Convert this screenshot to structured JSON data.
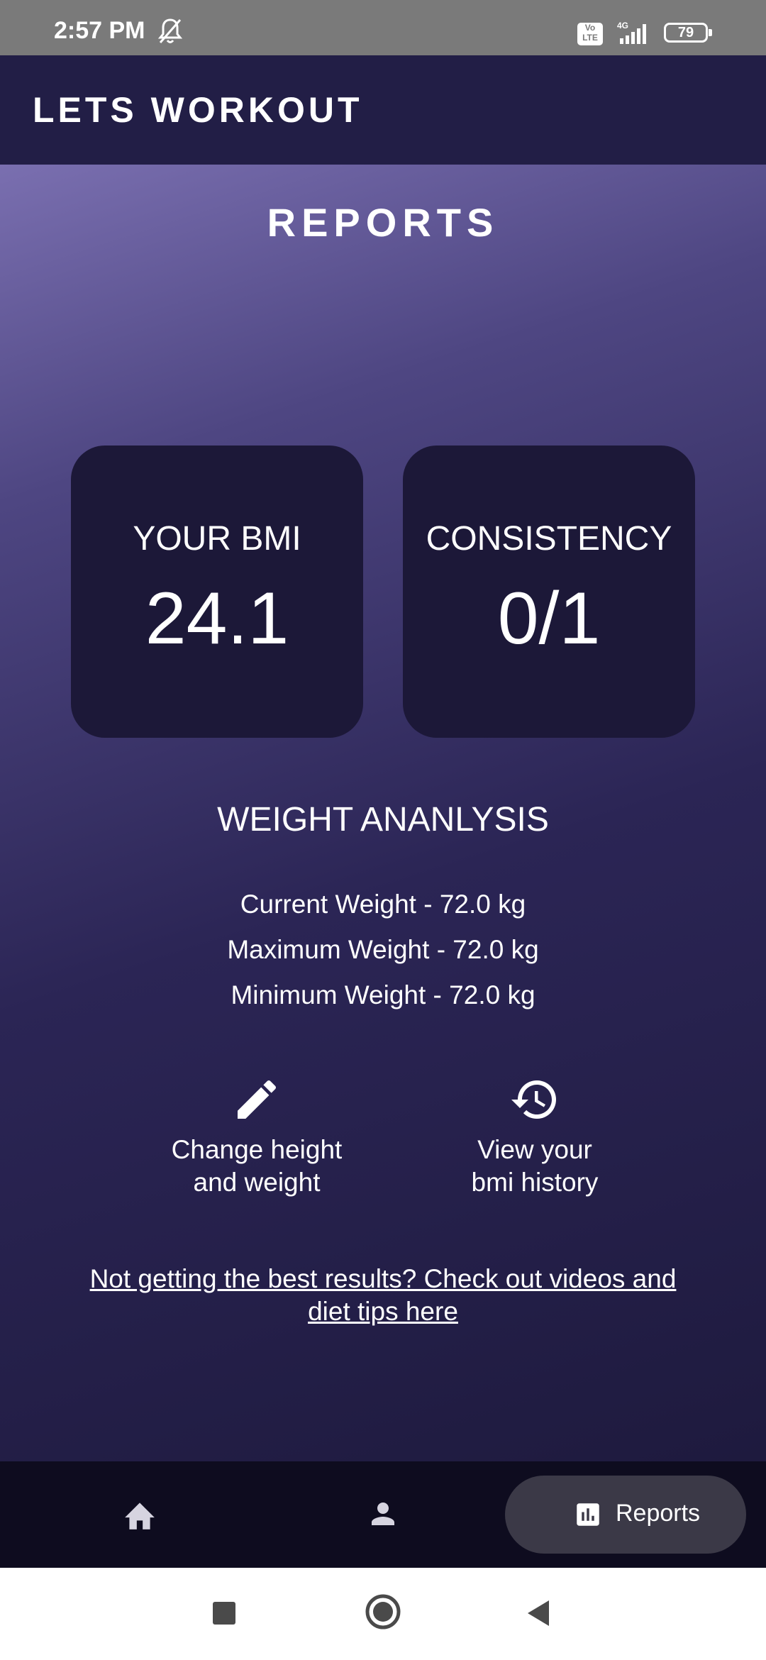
{
  "status_bar": {
    "time": "2:57 PM",
    "volte": "Vo LTE",
    "network": "4G",
    "battery": "79"
  },
  "app_bar": {
    "title": "LETS WORKOUT"
  },
  "page": {
    "title": "REPORTS"
  },
  "cards": {
    "bmi": {
      "label": "YOUR BMI",
      "value": "24.1"
    },
    "consistency": {
      "label": "CONSISTENCY",
      "value": "0/1"
    }
  },
  "weight_analysis": {
    "title": "WEIGHT ANANLYSIS",
    "current": "Current Weight - 72.0 kg",
    "maximum": "Maximum Weight - 72.0 kg",
    "minimum": "Minimum Weight - 72.0 kg"
  },
  "actions": {
    "edit": {
      "line1": "Change height",
      "line2": "and weight",
      "icon": "pencil-icon"
    },
    "history": {
      "line1": "View your",
      "line2": "bmi history",
      "icon": "history-icon"
    }
  },
  "tips_link": {
    "line1": "Not getting the best results? Check out videos and",
    "line2": "diet tips here"
  },
  "bottom_nav": {
    "items": [
      {
        "icon": "home-icon"
      },
      {
        "icon": "person-icon"
      },
      {
        "icon": "bar-chart-icon",
        "label": "Reports",
        "selected": true
      }
    ]
  },
  "colors": {
    "app_bar": "#221e46",
    "card": "#1c1838",
    "nav_bg": "#0e0c1f",
    "nav_selected": "#3b3947"
  }
}
